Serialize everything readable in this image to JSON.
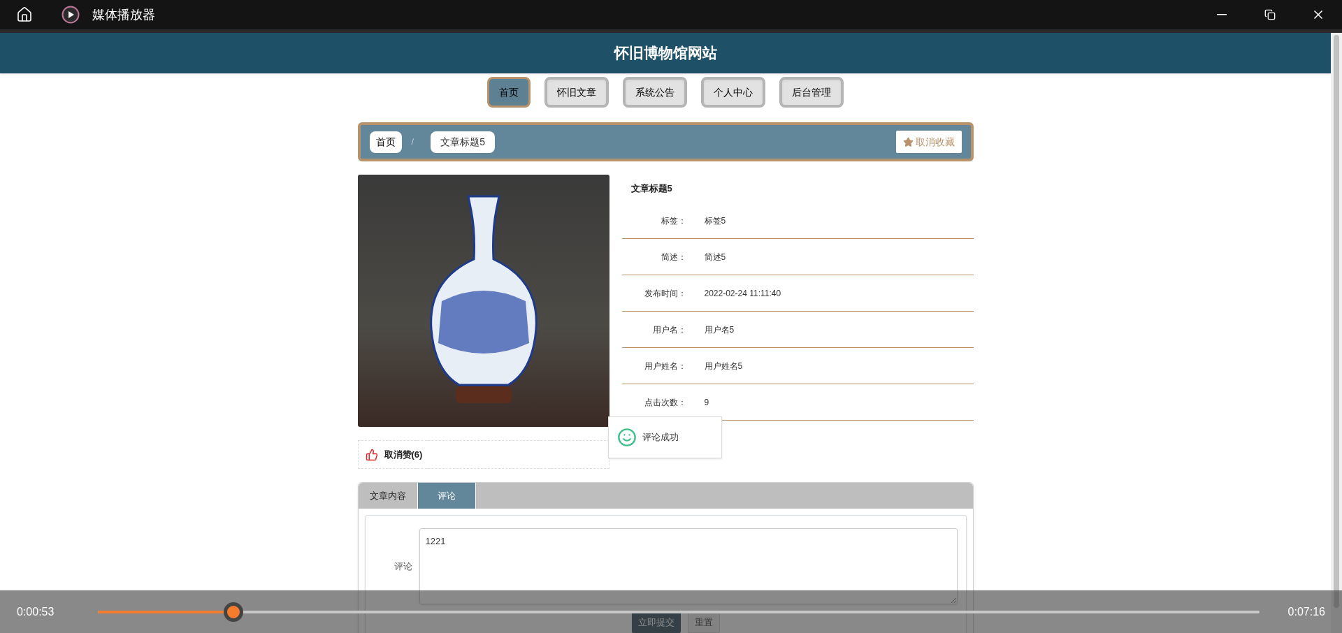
{
  "player": {
    "title": "媒体播放器",
    "elapsed": "0:00:53",
    "total": "0:07:16",
    "level": 0.117
  },
  "site": {
    "title": "怀旧博物馆网站",
    "nav": [
      {
        "label": "首页",
        "selected": true
      },
      {
        "label": "怀旧文章",
        "selected": false
      },
      {
        "label": "系统公告",
        "selected": false
      },
      {
        "label": "个人中心",
        "selected": false
      },
      {
        "label": "后台管理",
        "selected": false
      }
    ]
  },
  "breadcrumb": {
    "items": [
      "首页",
      "文章标题5"
    ],
    "separator": "/",
    "favorite_button": "取消收藏"
  },
  "article": {
    "title": "文章标题5",
    "fields": [
      {
        "label": "标签：",
        "value": "标签5"
      },
      {
        "label": "简述：",
        "value": "简述5"
      },
      {
        "label": "发布时间：",
        "value": "2022-02-24 11:11:40"
      },
      {
        "label": "用户名：",
        "value": "用户名5"
      },
      {
        "label": "用户姓名：",
        "value": "用户姓名5"
      },
      {
        "label": "点击次数：",
        "value": "9"
      }
    ]
  },
  "like": {
    "label": "取消赞(6)"
  },
  "tabs": [
    {
      "label": "文章内容",
      "selected": false
    },
    {
      "label": "评论",
      "selected": true
    }
  ],
  "comment_form": {
    "label": "评论",
    "value": "1221",
    "buttons": [
      "立即提交",
      "重置"
    ]
  },
  "toast": {
    "message": "评论成功"
  }
}
